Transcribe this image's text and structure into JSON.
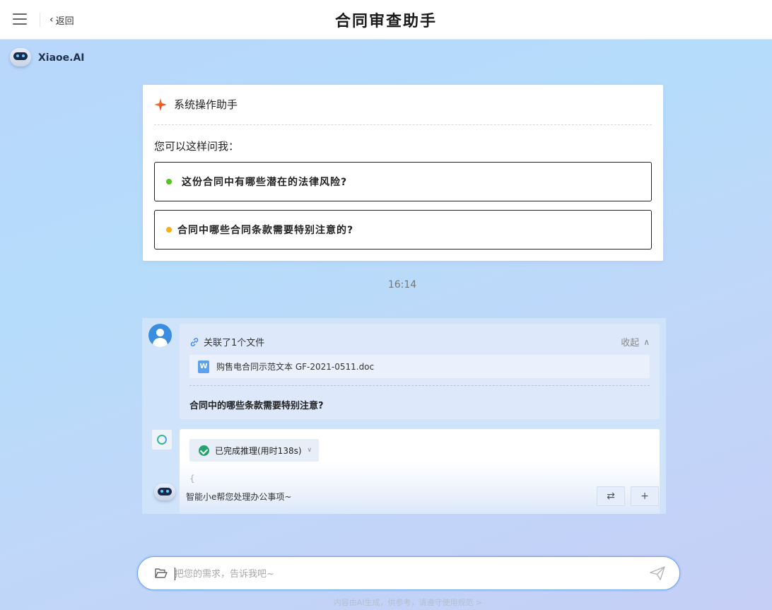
{
  "header": {
    "back_label": "返回",
    "title": "合同审查助手"
  },
  "brand": {
    "name": "Xiaoe.AI"
  },
  "welcome": {
    "title": "系统操作助手",
    "subtitle": "您可以这样问我：",
    "suggestions": [
      {
        "text": "这份合同中有哪些潜在的法律风险?",
        "dot_color": "#52c41a"
      },
      {
        "text": "合同中哪些合同条款需要特别注意的?",
        "dot_color": "#faad14"
      }
    ]
  },
  "timestamp": "16:14",
  "user_message": {
    "attachment_header": "关联了1个文件",
    "collapse_label": "收起",
    "file_icon_letter": "W",
    "file_name": "购售电合同示范文本 GF-2021-0511.doc",
    "question": "合同中的哪些条款需要特别注意?"
  },
  "assistant_message": {
    "reasoning_label": "已完成推理(用时138s)",
    "content_preview": "{"
  },
  "assistant_footer": {
    "tagline": "智能小e帮您处理办公事项~",
    "swap_symbol": "⇄",
    "plus_symbol": "+"
  },
  "input": {
    "placeholder": "把您的需求，告诉我吧~",
    "value": ""
  },
  "disclaimer": "内容由AI生成，供参考，请遵守使用规范 >"
}
